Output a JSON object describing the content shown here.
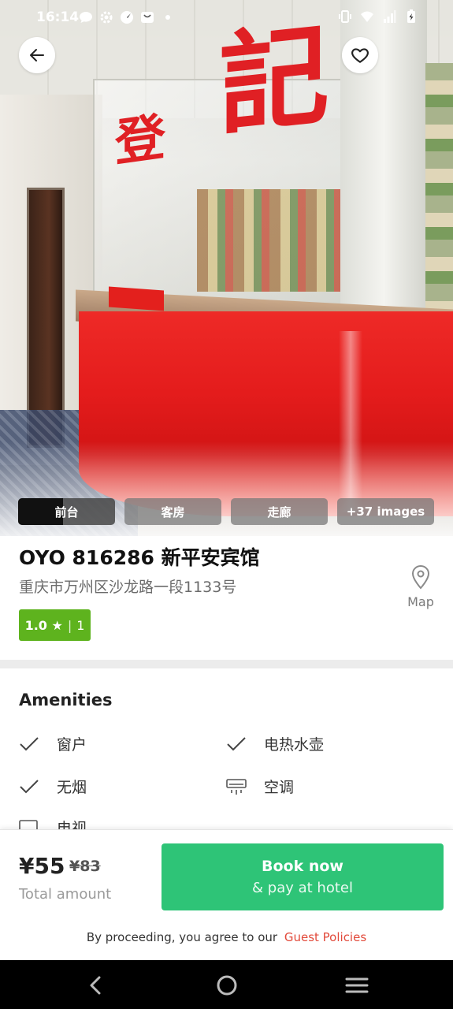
{
  "status_bar": {
    "time": "16:14",
    "left_icons": [
      "chat-bubble-icon",
      "settings-gear-icon",
      "compass-icon",
      "mail-bag-icon",
      "dot-icon"
    ],
    "right_icons": [
      "vibrate-icon",
      "wifi-icon",
      "signal-icon",
      "battery-charging-icon"
    ]
  },
  "hero": {
    "sign_char_1": "記",
    "sign_char_2": "登"
  },
  "photo_tabs": [
    {
      "label": "前台"
    },
    {
      "label": "客房"
    },
    {
      "label": "走廊"
    },
    {
      "label": "+37 images"
    }
  ],
  "hotel": {
    "name": "OYO 816286 新平安宾馆",
    "address": "重庆市万州区沙龙路一段1133号",
    "map_label": "Map",
    "rating": {
      "score": "1.0 ★",
      "separator": "|",
      "count": "1"
    }
  },
  "amenities": {
    "title": "Amenities",
    "items": [
      {
        "label": "窗户",
        "icon": "check-icon"
      },
      {
        "label": "电热水壶",
        "icon": "check-icon"
      },
      {
        "label": "无烟",
        "icon": "check-icon"
      },
      {
        "label": "空调",
        "icon": "air-conditioner-icon"
      },
      {
        "label": "电视",
        "icon": "tv-icon"
      }
    ]
  },
  "booking": {
    "price": "¥55",
    "old_price": "¥83",
    "total_label": "Total amount",
    "book_line1": "Book now",
    "book_line2": "& pay at hotel",
    "policy_text": "By proceeding, you agree to our",
    "policy_link": "Guest Policies"
  },
  "colors": {
    "accent_green": "#2ec477",
    "rating_green": "#5eb31e",
    "link_red": "#e24a3b"
  }
}
